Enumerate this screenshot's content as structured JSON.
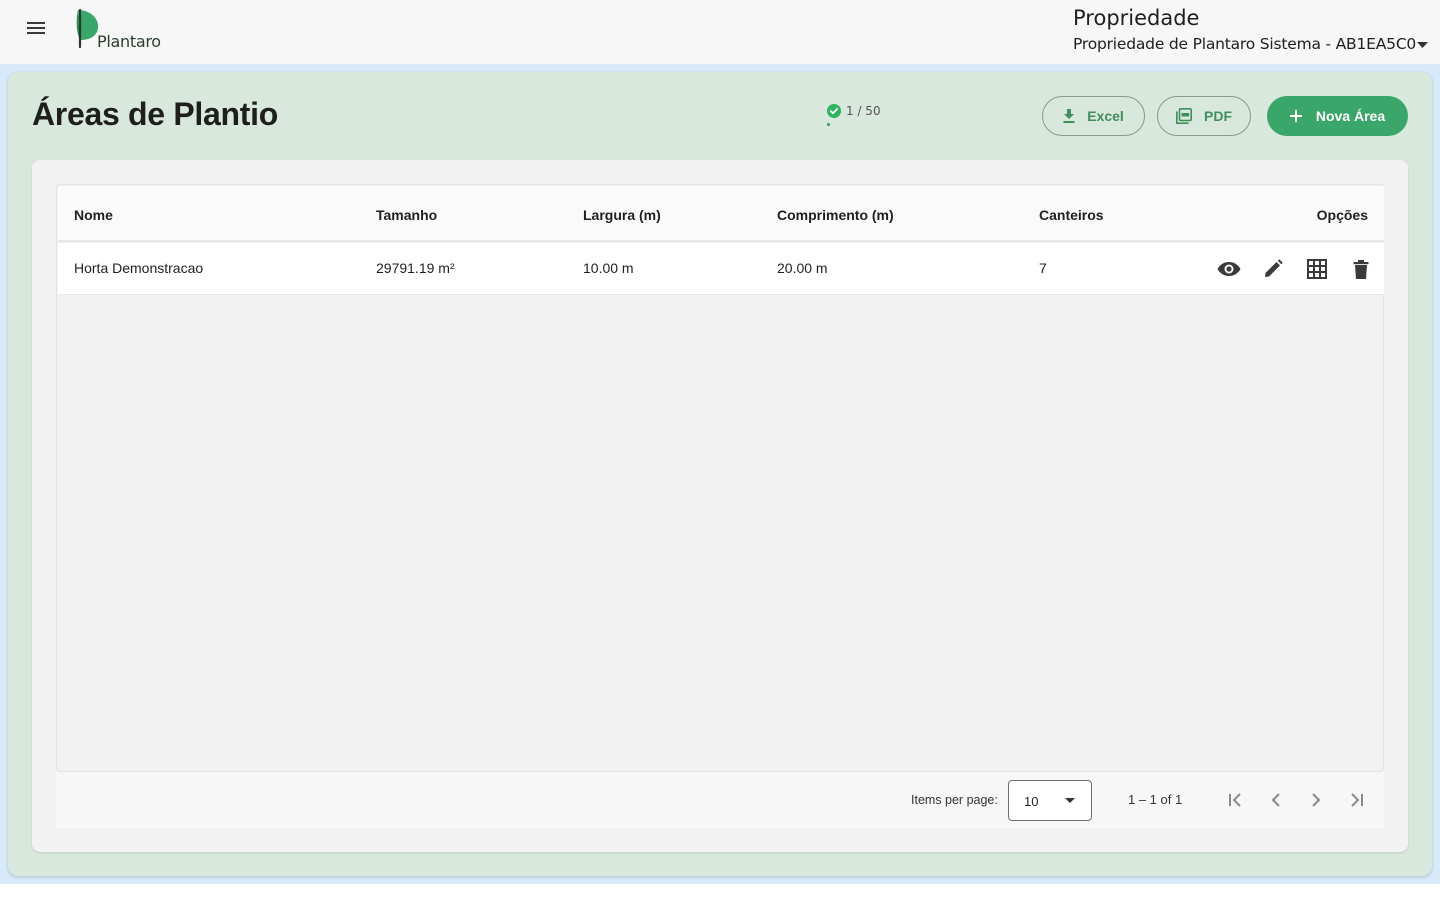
{
  "header": {
    "logo_text": "Plantaro",
    "property_label": "Propriedade",
    "property_selected": "Propriedade de Plantaro Sistema - AB1EA5C0",
    "icons": {
      "menu": "hamburger-menu-icon",
      "caret": "caret-down-icon"
    }
  },
  "page": {
    "title": "Áreas de Plantio",
    "quota": {
      "text": "1 / 50",
      "used": 1,
      "limit": 50,
      "color": "#3a9a5f"
    },
    "buttons": {
      "excel": "Excel",
      "pdf": "PDF",
      "new_area": "Nova Área"
    }
  },
  "table": {
    "columns": {
      "nome": "Nome",
      "tamanho": "Tamanho",
      "largura": "Largura (m)",
      "comprimento": "Comprimento (m)",
      "canteiros": "Canteiros",
      "opcoes": "Opções"
    },
    "rows": [
      {
        "nome": "Horta Demonstracao",
        "tamanho": "29791.19 m²",
        "largura": "10.00 m",
        "comprimento": "20.00 m",
        "canteiros": "7",
        "actions": [
          "eye-icon",
          "pencil-icon",
          "grid-icon",
          "trash-icon"
        ]
      }
    ]
  },
  "paginator": {
    "items_per_page_label": "Items per page:",
    "items_per_page_value": "10",
    "range": "1 – 1 of 1"
  },
  "colors": {
    "accent": "#3aa66a",
    "shell_background": "#d9e8dc",
    "outline_text": "#3f8f5d"
  }
}
